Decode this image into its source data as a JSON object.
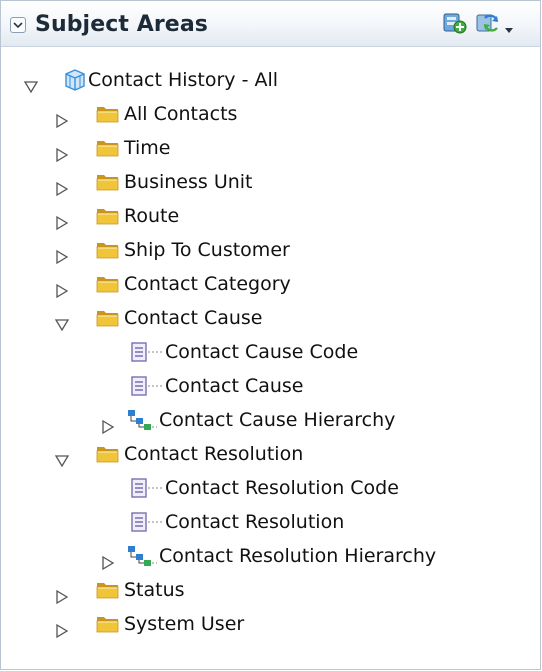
{
  "header": {
    "title": "Subject Areas"
  },
  "icons": {
    "collapse": "chevron-down-icon",
    "create": "create-analysis-icon",
    "refresh": "refresh-icon",
    "menu": "dropdown-arrow-icon"
  },
  "tree": {
    "root": {
      "label": "Contact History - All",
      "state": "expanded",
      "icon": "subject-area-cube-icon"
    },
    "items": [
      {
        "label": "All Contacts",
        "type": "folder",
        "state": "collapsed"
      },
      {
        "label": "Time",
        "type": "folder",
        "state": "collapsed"
      },
      {
        "label": "Business Unit",
        "type": "folder",
        "state": "collapsed"
      },
      {
        "label": "Route",
        "type": "folder",
        "state": "collapsed"
      },
      {
        "label": "Ship To Customer",
        "type": "folder",
        "state": "collapsed"
      },
      {
        "label": "Contact Category",
        "type": "folder",
        "state": "collapsed"
      },
      {
        "label": "Contact Cause",
        "type": "folder",
        "state": "expanded",
        "children": [
          {
            "label": "Contact Cause Code",
            "type": "column"
          },
          {
            "label": "Contact Cause",
            "type": "column"
          },
          {
            "label": "Contact Cause Hierarchy",
            "type": "hierarchy",
            "state": "collapsed"
          }
        ]
      },
      {
        "label": "Contact Resolution",
        "type": "folder",
        "state": "expanded",
        "children": [
          {
            "label": "Contact Resolution Code",
            "type": "column"
          },
          {
            "label": "Contact Resolution",
            "type": "column"
          },
          {
            "label": "Contact Resolution Hierarchy",
            "type": "hierarchy",
            "state": "collapsed"
          }
        ]
      },
      {
        "label": "Status",
        "type": "folder",
        "state": "collapsed"
      },
      {
        "label": "System User",
        "type": "folder",
        "state": "collapsed"
      }
    ]
  },
  "colors": {
    "folder": "#f0c53a",
    "folder_dark": "#c9951d",
    "column_icon": "#7a6fb0",
    "hierarchy_icon": "#2f7fd0",
    "cube": "#3a8fd9"
  }
}
